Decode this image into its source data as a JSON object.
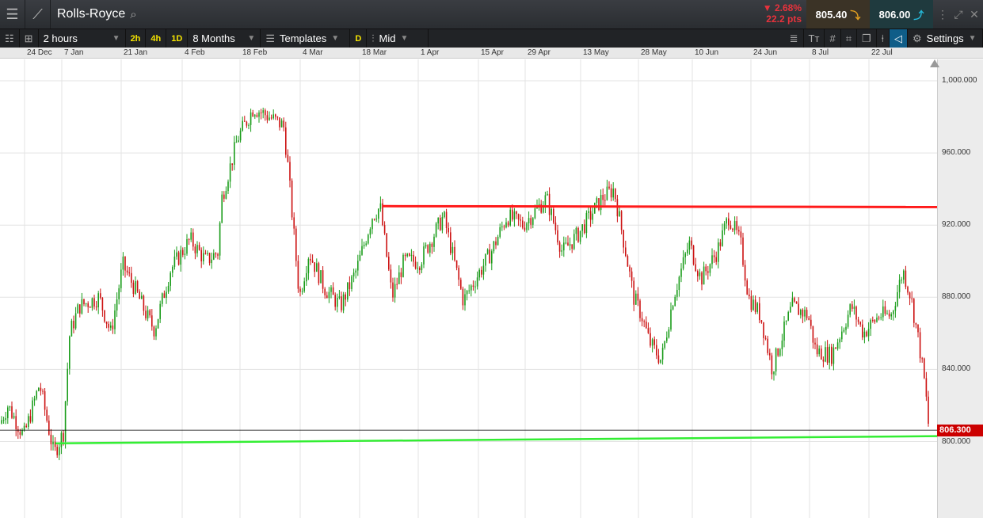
{
  "header": {
    "title": "Rolls-Royce",
    "change_pct": "▼ 2.68%",
    "change_pts": "22.2 pts",
    "sell": "805.40",
    "buy": "806.00"
  },
  "toolbar": {
    "interval": "2 hours",
    "quick": [
      "2h",
      "4h",
      "1D"
    ],
    "range": "8 Months",
    "templates": "Templates",
    "d": "D",
    "price_type": "Mid",
    "settings": "Settings"
  },
  "x_labels": [
    "24 Dec",
    "7 Jan",
    "21 Jan",
    "4 Feb",
    "18 Feb",
    "4 Mar",
    "18 Mar",
    "1 Apr",
    "15 Apr",
    "29 Apr",
    "13 May",
    "28 May",
    "10 Jun",
    "24 Jun",
    "8 Jul",
    "22 Jul"
  ],
  "y_labels": [
    "1,000.000",
    "960.000",
    "920.000",
    "880.000",
    "840.000",
    "800.000"
  ],
  "last_price": "806.300",
  "colors": {
    "up": "#1a9c1a",
    "down": "#cc1111",
    "resistance": "#ff1a1a",
    "support": "#33ee33"
  },
  "chart_data": {
    "type": "candlestick",
    "title": "Rolls-Royce",
    "ylim": [
      780,
      1020
    ],
    "path": [
      [
        0,
        810
      ],
      [
        10,
        820
      ],
      [
        30,
        803
      ],
      [
        50,
        832
      ],
      [
        68,
        793
      ],
      [
        80,
        805
      ],
      [
        88,
        860
      ],
      [
        100,
        875
      ],
      [
        125,
        880
      ],
      [
        140,
        860
      ],
      [
        155,
        898
      ],
      [
        170,
        885
      ],
      [
        185,
        870
      ],
      [
        195,
        862
      ],
      [
        215,
        895
      ],
      [
        240,
        912
      ],
      [
        260,
        900
      ],
      [
        275,
        905
      ],
      [
        280,
        935
      ],
      [
        300,
        968
      ],
      [
        320,
        985
      ],
      [
        340,
        980
      ],
      [
        358,
        975
      ],
      [
        363,
        955
      ],
      [
        370,
        920
      ],
      [
        378,
        880
      ],
      [
        390,
        905
      ],
      [
        410,
        885
      ],
      [
        430,
        875
      ],
      [
        450,
        895
      ],
      [
        470,
        925
      ],
      [
        480,
        930
      ],
      [
        495,
        880
      ],
      [
        510,
        900
      ],
      [
        530,
        900
      ],
      [
        560,
        925
      ],
      [
        585,
        878
      ],
      [
        600,
        890
      ],
      [
        620,
        905
      ],
      [
        640,
        925
      ],
      [
        660,
        920
      ],
      [
        690,
        935
      ],
      [
        710,
        905
      ],
      [
        730,
        915
      ],
      [
        760,
        935
      ],
      [
        775,
        940
      ],
      [
        790,
        905
      ],
      [
        800,
        880
      ],
      [
        810,
        870
      ],
      [
        820,
        855
      ],
      [
        835,
        845
      ],
      [
        850,
        880
      ],
      [
        870,
        910
      ],
      [
        885,
        890
      ],
      [
        905,
        905
      ],
      [
        920,
        925
      ],
      [
        935,
        910
      ],
      [
        945,
        880
      ],
      [
        960,
        870
      ],
      [
        975,
        840
      ],
      [
        985,
        855
      ],
      [
        1000,
        875
      ],
      [
        1020,
        870
      ],
      [
        1030,
        850
      ],
      [
        1050,
        848
      ],
      [
        1075,
        875
      ],
      [
        1090,
        860
      ],
      [
        1110,
        870
      ],
      [
        1125,
        870
      ],
      [
        1140,
        895
      ],
      [
        1150,
        880
      ],
      [
        1160,
        855
      ],
      [
        1168,
        830
      ],
      [
        1172,
        810
      ],
      [
        1175,
        806
      ]
    ],
    "resistance_line": [
      930.5,
      930
    ],
    "support_line": [
      799,
      803
    ],
    "current": 806.3
  }
}
